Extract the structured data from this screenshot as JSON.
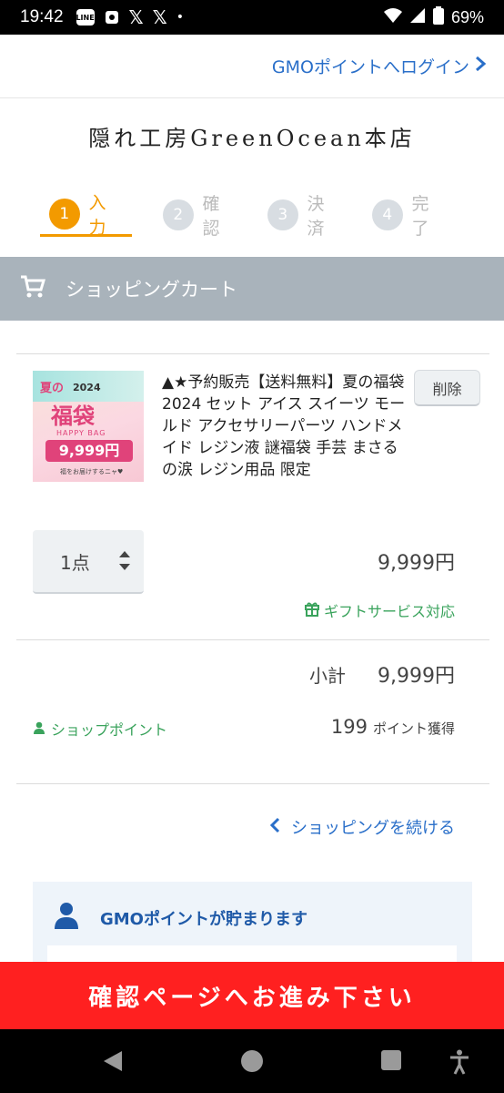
{
  "status_bar": {
    "time": "19:42",
    "line_label": "LINE",
    "x_icons": [
      "𝕏",
      "𝕏"
    ],
    "dot": "•",
    "battery": "69%"
  },
  "header": {
    "login_link": "GMOポイントへログイン",
    "shop_name": "隠れ工房GreenOcean本店"
  },
  "steps": [
    {
      "num": "1",
      "label": "入力",
      "active": true
    },
    {
      "num": "2",
      "label": "確認",
      "active": false
    },
    {
      "num": "3",
      "label": "決済",
      "active": false
    },
    {
      "num": "4",
      "label": "完了",
      "active": false
    }
  ],
  "cart": {
    "title": "ショッピングカート"
  },
  "item": {
    "title": "▲★予約販売【送料無料】夏の福袋2024 セット アイス スイーツ モールド アクセサリーパーツ ハンドメイド レジン液 謎福袋 手芸 まさるの涙 レジン用品 限定",
    "delete_label": "削除",
    "quantity": "1点",
    "price": "9,999円",
    "gift": "ギフトサービス対応",
    "thumb": {
      "natsu": "夏の",
      "year": "2024",
      "fuku": "福袋",
      "happy": "HAPPY BAG",
      "price": "9,999円",
      "note": "福をお届けするニャ♥"
    }
  },
  "summary": {
    "subtotal_label": "小計",
    "subtotal_value": "9,999円",
    "shop_point_label": "ショップポイント",
    "points": "199",
    "points_suffix": "ポイント獲得"
  },
  "continue_label": "ショッピングを続ける",
  "gmo_box": {
    "title": "GMOポイントが貯まります"
  },
  "banner": {
    "text": "確認ページへお進み下さい"
  },
  "colors": {
    "accent": "#f39a00",
    "link": "#2a6fc9",
    "green": "#3aa35c",
    "banner": "#ff2020",
    "cart_header": "#a9b3bb"
  }
}
